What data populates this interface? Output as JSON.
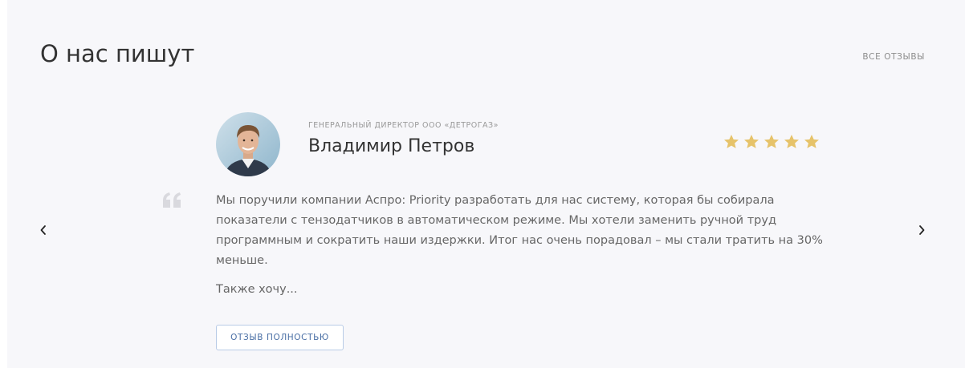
{
  "section": {
    "title": "О нас пишут",
    "all_reviews_label": "ВСЕ ОТЗЫВЫ"
  },
  "slider": {
    "prev_icon": "chevron-left-icon",
    "next_icon": "chevron-right-icon"
  },
  "review": {
    "role": "ГЕНЕРАЛЬНЫЙ ДИРЕКТОР ООО «ДЕТРОГАЗ»",
    "name": "Владимир Петров",
    "rating": 5,
    "rating_max": 5,
    "text": "Мы поручили компании Аспро: Priority разработать для нас систему, которая бы собирала показатели с тензодатчиков в автоматическом режиме. Мы хотели заменить ручной труд программным и сократить наши издержки. Итог нас очень порадовал – мы стали тратить на 30% меньше.",
    "more": "Также хочу...",
    "button_label": "ОТЗЫВ ПОЛНОСТЬЮ"
  },
  "colors": {
    "background": "#f7f7fa",
    "star": "#e6c36a",
    "button_border": "#b8cbe6",
    "button_text": "#4a6fa5",
    "quote_icon": "#d9d9de"
  }
}
